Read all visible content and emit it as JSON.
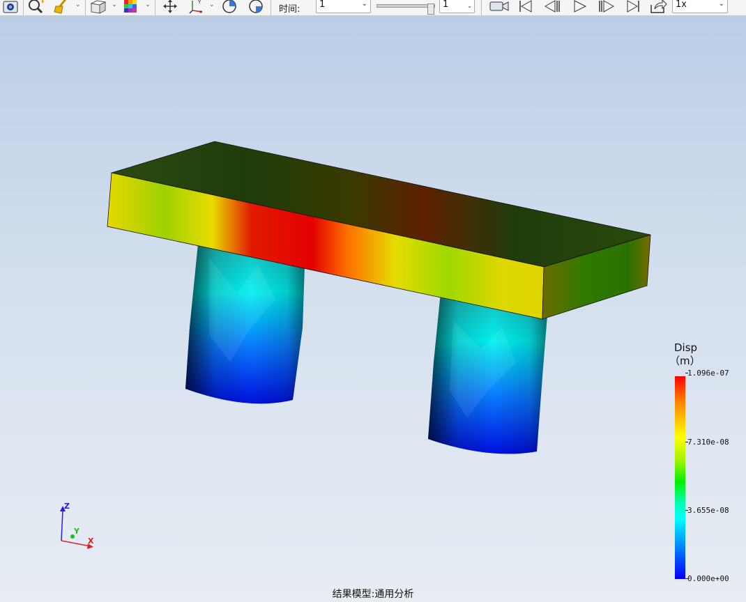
{
  "toolbar": {
    "time_label": "时间:",
    "time_select_value": "1",
    "frame_input_value": "1",
    "speed_select_value": "1x"
  },
  "icons": [
    "screenshot-icon",
    "zoom-icon",
    "clear-icon",
    "view-cube-icon",
    "color-grid-icon",
    "pan-icon",
    "axis-icon",
    "rotate-icon",
    "section-icon",
    "record-icon",
    "first-frame-icon",
    "previous-frame-icon",
    "play-icon",
    "next-frame-icon",
    "last-frame-icon",
    "export-icon"
  ],
  "legend": {
    "title": "Disp",
    "unit": "（m）",
    "ticks": [
      "1.096e-07",
      "7.310e-08",
      "3.655e-08",
      "0.000e+00"
    ],
    "max": 1.096e-07,
    "min": 0.0
  },
  "axes": {
    "x": "X",
    "y": "Y",
    "z": "Z"
  },
  "status_text": "结果模型:通用分析"
}
